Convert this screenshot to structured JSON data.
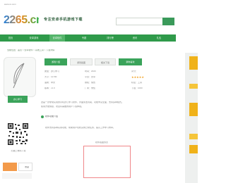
{
  "colors": {
    "brand_green": "#2f9a4a",
    "accent_green": "#3aa35a",
    "accent_yellow": "#f0b21a",
    "accent_orange": "#f39a4a",
    "preview_border": "#f0878a"
  },
  "header": {
    "top_text": "www.xx.com",
    "logo_text": "2265.cn",
    "slogan": "专注安卓手机游戏下载"
  },
  "search": {
    "button_label": ""
  },
  "nav": {
    "items": [
      {
        "label": "首页"
      },
      {
        "label": "安卓游戏"
      },
      {
        "label": "安卓软件"
      },
      {
        "label": "专题"
      },
      {
        "label": "排行榜"
      },
      {
        "label": "资讯"
      },
      {
        "label": "礼包"
      }
    ]
  },
  "breadcrumb": "当前位置：首页 > 安卓软件 > 系统工具 > 下载详情",
  "app": {
    "name_badge": "办公学习",
    "qr_caption": "扫描二维码下载"
  },
  "tabs": [
    {
      "label": "游戏介绍"
    },
    {
      "label": "游戏截图"
    },
    {
      "label": "相关下载"
    },
    {
      "label": "猜你喜欢"
    }
  ],
  "info": {
    "left": [
      "类型：办公学习",
      "大小：12.5M",
      "语言：中文",
      "版本：v1.0"
    ],
    "mid": [
      "时间：2020",
      "平台：安卓",
      "授权：免费",
      "厂商：未知"
    ],
    "right": [
      "评分：",
      "★★★★★",
      "标签：工具",
      "下载：1000"
    ]
  },
  "description": {
    "line1": "这是一款非常实用的手机办公学习软件，界面简洁清爽，功能丰富全面，支持多种格式。",
    "line2": "使用方便快捷，欢迎有需要的用户下载体验。",
    "section_heading": "软件功能介绍",
    "section_text": "软件支持多种实用功能，帮助用户轻松完成日常任务，提高工作学习效率。"
  },
  "preview": {
    "label": "软件截图预览"
  },
  "buttons": {
    "white_label": "收藏"
  }
}
